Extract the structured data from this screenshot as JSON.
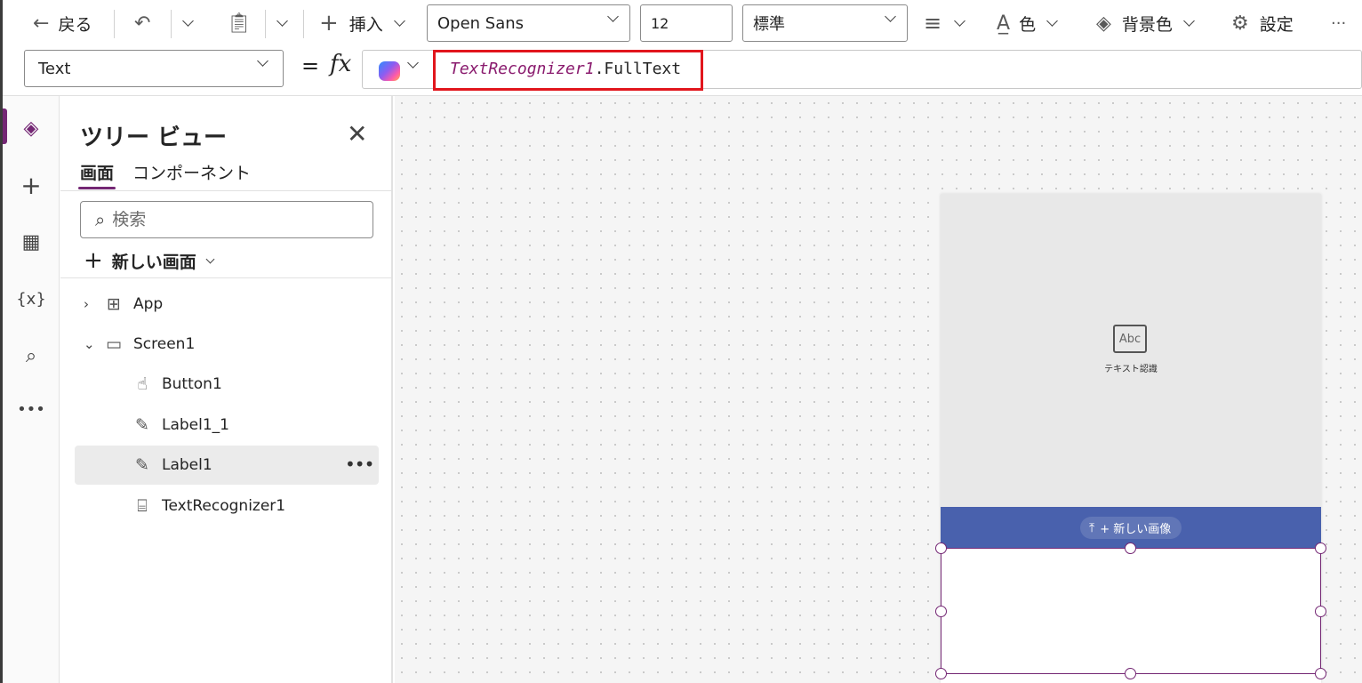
{
  "toolbar": {
    "back_label": "戻る",
    "insert_label": "挿入",
    "font_family": "Open Sans",
    "font_size": "12",
    "font_weight": "標準",
    "color_label": "色",
    "fill_label": "背景色",
    "settings_label": "設定"
  },
  "formula": {
    "property": "Text",
    "equals": "=",
    "fx": "fx",
    "ref": "TextRecognizer1",
    "member": ".FullText"
  },
  "tree": {
    "title": "ツリー ビュー",
    "tabs": [
      "画面",
      "コンポーネント"
    ],
    "search_placeholder": "検索",
    "new_screen_label": "新しい画面",
    "nodes": [
      "App",
      "Screen1",
      "Button1",
      "Label1_1",
      "Label1",
      "TextRecognizer1"
    ]
  },
  "canvas": {
    "ocr_icon_text": "Abc",
    "ocr_label": "テキスト認識",
    "new_image_label": "+ 新しい画像"
  },
  "colors": {
    "accent": "#742774",
    "highlight": "#e1161d",
    "bar_blue": "#4961ad"
  }
}
